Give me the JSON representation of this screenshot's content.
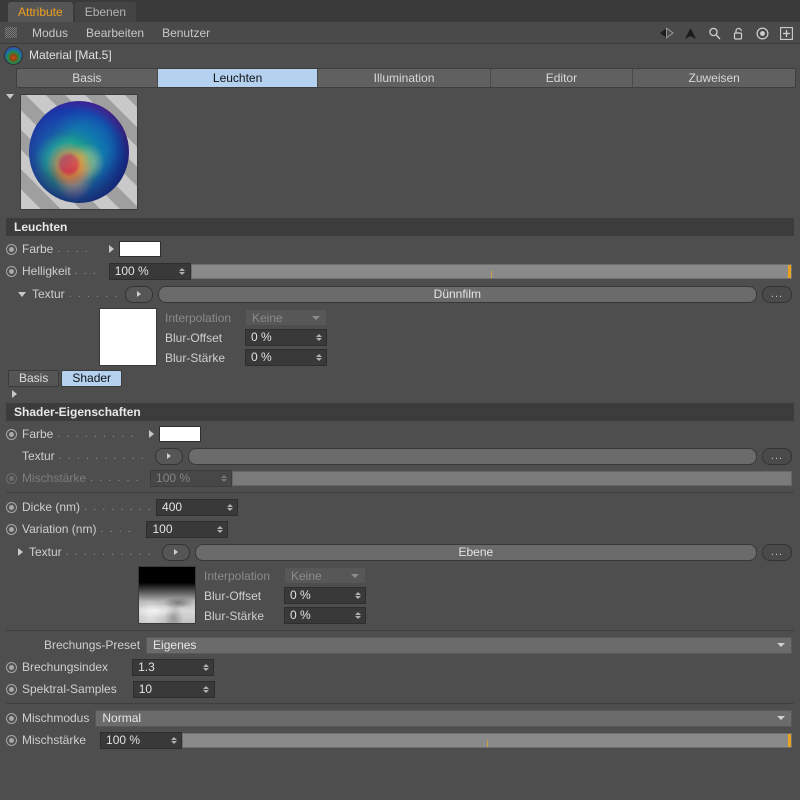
{
  "window": {
    "tabs": [
      {
        "label": "Attribute",
        "active": true
      },
      {
        "label": "Ebenen",
        "active": false
      }
    ]
  },
  "menubar": {
    "grip_icon": "grip-dots-icon",
    "items": [
      "Modus",
      "Bearbeiten",
      "Benutzer"
    ],
    "icons": [
      "back-arrow-icon",
      "forward-arrow-icon",
      "up-arrow-icon",
      "search-icon",
      "lock-icon",
      "target-icon",
      "plus-icon"
    ]
  },
  "object": {
    "icon": "material-sphere-icon",
    "title": "Material [Mat.5]"
  },
  "main_tabs": [
    {
      "label": "Basis",
      "active": false
    },
    {
      "label": "Leuchten",
      "active": true
    },
    {
      "label": "Illumination",
      "active": false
    },
    {
      "label": "Editor",
      "active": false
    },
    {
      "label": "Zuweisen",
      "active": false
    }
  ],
  "preview": {
    "name": "material-preview-sphere"
  },
  "leuchten": {
    "section_title": "Leuchten",
    "farbe": {
      "label": "Farbe",
      "leader": ". . . .",
      "swatch_color": "#ffffff"
    },
    "helligkeit": {
      "label": "Helligkeit",
      "leader": ". . .",
      "value": "100 %",
      "slider_percent": 100
    },
    "textur": {
      "label": "Textur",
      "leader": ". . . . . . .",
      "value": "Dünnfilm",
      "more_label": "...",
      "expanded": true
    },
    "textur_sub": {
      "interpolation": {
        "label": "Interpolation",
        "value": "Keine",
        "disabled": true
      },
      "blur_offset": {
        "label": "Blur-Offset",
        "value": "0 %"
      },
      "blur_staerke": {
        "label": "Blur-Stärke",
        "value": "0 %"
      }
    }
  },
  "shader_tabs": [
    {
      "label": "Basis",
      "active": false
    },
    {
      "label": "Shader",
      "active": true
    }
  ],
  "shader": {
    "section_title": "Shader-Eigenschaften",
    "farbe": {
      "label": "Farbe",
      "leader": ". . . . . . . . .",
      "swatch_color": "#ffffff"
    },
    "textur": {
      "label": "Textur",
      "leader": ". . . . . . . . . . .",
      "value": "",
      "more_label": "..."
    },
    "mischstaerke": {
      "label": "Mischstärke",
      "leader": ". . . . . .",
      "value": "100 %",
      "slider_percent": 100,
      "disabled": true
    },
    "dicke": {
      "label": "Dicke (nm)",
      "leader": ". . . . . . . .",
      "value": "400"
    },
    "variation": {
      "label": "Variation (nm)",
      "leader": ". . . .",
      "value": "100"
    },
    "textur2": {
      "label": "Textur",
      "leader": ". . . . . . . . . . .",
      "value": "Ebene",
      "more_label": "...",
      "expanded": false
    },
    "textur2_sub": {
      "interpolation": {
        "label": "Interpolation",
        "value": "Keine",
        "disabled": true
      },
      "blur_offset": {
        "label": "Blur-Offset",
        "value": "0 %"
      },
      "blur_staerke": {
        "label": "Blur-Stärke",
        "value": "0 %"
      }
    },
    "brechungs_preset": {
      "label": "Brechungs-Preset",
      "value": "Eigenes"
    },
    "brechungsindex": {
      "label": "Brechungsindex",
      "value": "1.3"
    },
    "spektral_samples": {
      "label": "Spektral-Samples",
      "value": "10"
    }
  },
  "footer": {
    "mischmodus": {
      "label": "Mischmodus",
      "value": "Normal"
    },
    "mischstaerke": {
      "label": "Mischstärke",
      "value": "100 %",
      "slider_percent": 100
    }
  },
  "colors": {
    "panel_bg": "#4e4e4e",
    "accent_tab": "#b4d2f0",
    "accent_title": "#f0a020",
    "slider_marker": "#e8a21e"
  }
}
